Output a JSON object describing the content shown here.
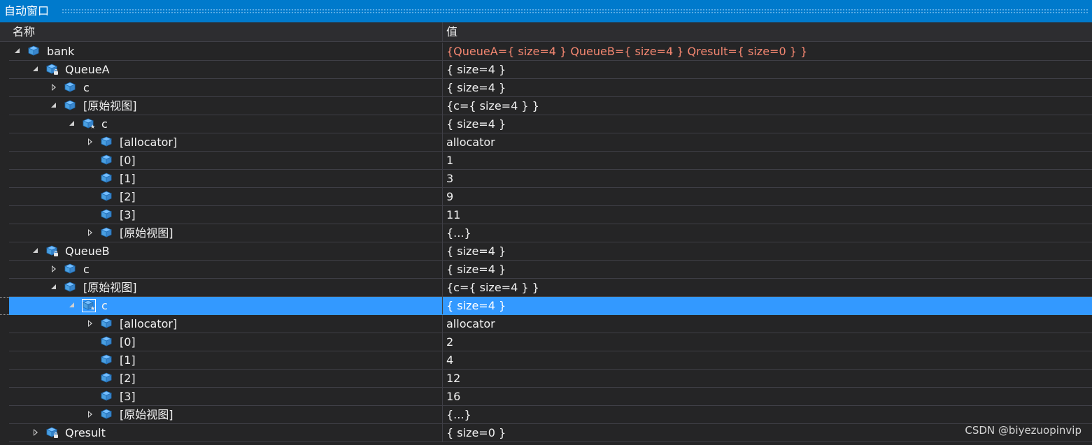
{
  "window": {
    "title": "自动窗口"
  },
  "columns": {
    "name": "名称",
    "value": "值"
  },
  "rows": [
    {
      "level": 0,
      "expander": "expanded",
      "icon": "field-icon",
      "badge": "",
      "name": "bank",
      "value": "{QueueA={ size=4 } QueueB={ size=4 } Qresult={ size=0 } }",
      "changed": true,
      "selected": false
    },
    {
      "level": 1,
      "expander": "expanded",
      "icon": "field-icon",
      "badge": "lock",
      "name": "QueueA",
      "value": "{ size=4 }",
      "changed": false,
      "selected": false
    },
    {
      "level": 2,
      "expander": "collapsed",
      "icon": "field-icon",
      "badge": "",
      "name": "c",
      "value": "{ size=4 }",
      "changed": false,
      "selected": false
    },
    {
      "level": 2,
      "expander": "expanded",
      "icon": "field-icon",
      "badge": "",
      "name": "[原始视图]",
      "value": "{c={ size=4 } }",
      "changed": false,
      "selected": false
    },
    {
      "level": 3,
      "expander": "expanded",
      "icon": "field-icon",
      "badge": "star",
      "name": "c",
      "value": "{ size=4 }",
      "changed": false,
      "selected": false
    },
    {
      "level": 4,
      "expander": "collapsed",
      "icon": "field-icon",
      "badge": "",
      "name": "[allocator]",
      "value": "allocator",
      "changed": false,
      "selected": false
    },
    {
      "level": 4,
      "expander": "none",
      "icon": "field-icon",
      "badge": "",
      "name": "[0]",
      "value": "1",
      "changed": false,
      "selected": false
    },
    {
      "level": 4,
      "expander": "none",
      "icon": "field-icon",
      "badge": "",
      "name": "[1]",
      "value": "3",
      "changed": false,
      "selected": false
    },
    {
      "level": 4,
      "expander": "none",
      "icon": "field-icon",
      "badge": "",
      "name": "[2]",
      "value": "9",
      "changed": false,
      "selected": false
    },
    {
      "level": 4,
      "expander": "none",
      "icon": "field-icon",
      "badge": "",
      "name": "[3]",
      "value": "11",
      "changed": false,
      "selected": false
    },
    {
      "level": 4,
      "expander": "collapsed",
      "icon": "field-icon",
      "badge": "",
      "name": "[原始视图]",
      "value": "{...}",
      "changed": false,
      "selected": false
    },
    {
      "level": 1,
      "expander": "expanded",
      "icon": "field-icon",
      "badge": "lock",
      "name": "QueueB",
      "value": "{ size=4 }",
      "changed": false,
      "selected": false
    },
    {
      "level": 2,
      "expander": "collapsed",
      "icon": "field-icon",
      "badge": "",
      "name": "c",
      "value": "{ size=4 }",
      "changed": false,
      "selected": false
    },
    {
      "level": 2,
      "expander": "expanded",
      "icon": "field-icon",
      "badge": "",
      "name": "[原始视图]",
      "value": "{c={ size=4 } }",
      "changed": false,
      "selected": false
    },
    {
      "level": 3,
      "expander": "expanded",
      "icon": "field-icon",
      "badge": "star",
      "name": "c",
      "value": "{ size=4 }",
      "changed": false,
      "selected": true
    },
    {
      "level": 4,
      "expander": "collapsed",
      "icon": "field-icon",
      "badge": "",
      "name": "[allocator]",
      "value": "allocator",
      "changed": false,
      "selected": false
    },
    {
      "level": 4,
      "expander": "none",
      "icon": "field-icon",
      "badge": "",
      "name": "[0]",
      "value": "2",
      "changed": false,
      "selected": false
    },
    {
      "level": 4,
      "expander": "none",
      "icon": "field-icon",
      "badge": "",
      "name": "[1]",
      "value": "4",
      "changed": false,
      "selected": false
    },
    {
      "level": 4,
      "expander": "none",
      "icon": "field-icon",
      "badge": "",
      "name": "[2]",
      "value": "12",
      "changed": false,
      "selected": false
    },
    {
      "level": 4,
      "expander": "none",
      "icon": "field-icon",
      "badge": "",
      "name": "[3]",
      "value": "16",
      "changed": false,
      "selected": false
    },
    {
      "level": 4,
      "expander": "collapsed",
      "icon": "field-icon",
      "badge": "",
      "name": "[原始视图]",
      "value": "{...}",
      "changed": false,
      "selected": false
    },
    {
      "level": 1,
      "expander": "collapsed",
      "icon": "field-icon",
      "badge": "lock",
      "name": "Qresult",
      "value": "{ size=0 }",
      "changed": false,
      "selected": false
    }
  ],
  "watermark": "CSDN @biyezuopinvip",
  "colors": {
    "titlebar": "#007acc",
    "background": "#252526",
    "selection": "#3399ff",
    "changed_value": "#f48771",
    "icon_fill": "#75beff"
  }
}
